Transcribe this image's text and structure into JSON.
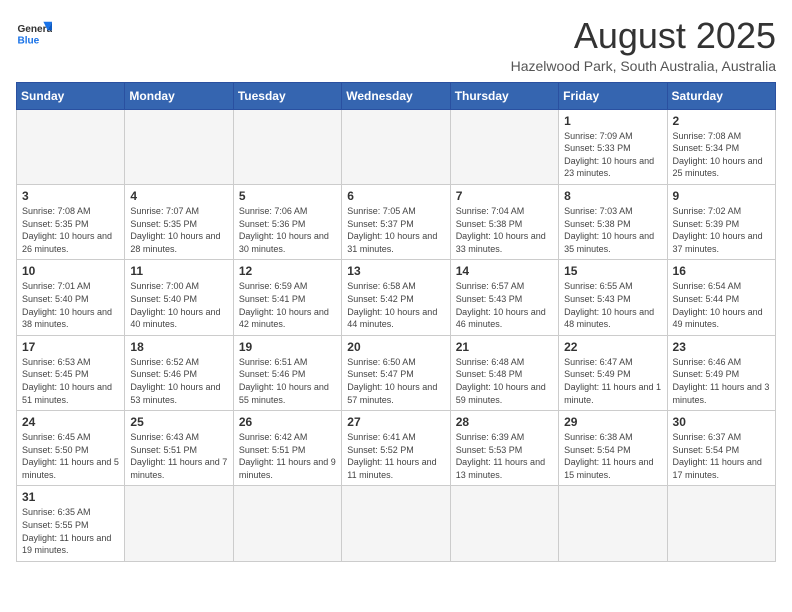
{
  "header": {
    "logo_general": "General",
    "logo_blue": "Blue",
    "title": "August 2025",
    "subtitle": "Hazelwood Park, South Australia, Australia"
  },
  "weekdays": [
    "Sunday",
    "Monday",
    "Tuesday",
    "Wednesday",
    "Thursday",
    "Friday",
    "Saturday"
  ],
  "weeks": [
    [
      {
        "day": "",
        "info": ""
      },
      {
        "day": "",
        "info": ""
      },
      {
        "day": "",
        "info": ""
      },
      {
        "day": "",
        "info": ""
      },
      {
        "day": "",
        "info": ""
      },
      {
        "day": "1",
        "info": "Sunrise: 7:09 AM\nSunset: 5:33 PM\nDaylight: 10 hours and 23 minutes."
      },
      {
        "day": "2",
        "info": "Sunrise: 7:08 AM\nSunset: 5:34 PM\nDaylight: 10 hours and 25 minutes."
      }
    ],
    [
      {
        "day": "3",
        "info": "Sunrise: 7:08 AM\nSunset: 5:35 PM\nDaylight: 10 hours and 26 minutes."
      },
      {
        "day": "4",
        "info": "Sunrise: 7:07 AM\nSunset: 5:35 PM\nDaylight: 10 hours and 28 minutes."
      },
      {
        "day": "5",
        "info": "Sunrise: 7:06 AM\nSunset: 5:36 PM\nDaylight: 10 hours and 30 minutes."
      },
      {
        "day": "6",
        "info": "Sunrise: 7:05 AM\nSunset: 5:37 PM\nDaylight: 10 hours and 31 minutes."
      },
      {
        "day": "7",
        "info": "Sunrise: 7:04 AM\nSunset: 5:38 PM\nDaylight: 10 hours and 33 minutes."
      },
      {
        "day": "8",
        "info": "Sunrise: 7:03 AM\nSunset: 5:38 PM\nDaylight: 10 hours and 35 minutes."
      },
      {
        "day": "9",
        "info": "Sunrise: 7:02 AM\nSunset: 5:39 PM\nDaylight: 10 hours and 37 minutes."
      }
    ],
    [
      {
        "day": "10",
        "info": "Sunrise: 7:01 AM\nSunset: 5:40 PM\nDaylight: 10 hours and 38 minutes."
      },
      {
        "day": "11",
        "info": "Sunrise: 7:00 AM\nSunset: 5:40 PM\nDaylight: 10 hours and 40 minutes."
      },
      {
        "day": "12",
        "info": "Sunrise: 6:59 AM\nSunset: 5:41 PM\nDaylight: 10 hours and 42 minutes."
      },
      {
        "day": "13",
        "info": "Sunrise: 6:58 AM\nSunset: 5:42 PM\nDaylight: 10 hours and 44 minutes."
      },
      {
        "day": "14",
        "info": "Sunrise: 6:57 AM\nSunset: 5:43 PM\nDaylight: 10 hours and 46 minutes."
      },
      {
        "day": "15",
        "info": "Sunrise: 6:55 AM\nSunset: 5:43 PM\nDaylight: 10 hours and 48 minutes."
      },
      {
        "day": "16",
        "info": "Sunrise: 6:54 AM\nSunset: 5:44 PM\nDaylight: 10 hours and 49 minutes."
      }
    ],
    [
      {
        "day": "17",
        "info": "Sunrise: 6:53 AM\nSunset: 5:45 PM\nDaylight: 10 hours and 51 minutes."
      },
      {
        "day": "18",
        "info": "Sunrise: 6:52 AM\nSunset: 5:46 PM\nDaylight: 10 hours and 53 minutes."
      },
      {
        "day": "19",
        "info": "Sunrise: 6:51 AM\nSunset: 5:46 PM\nDaylight: 10 hours and 55 minutes."
      },
      {
        "day": "20",
        "info": "Sunrise: 6:50 AM\nSunset: 5:47 PM\nDaylight: 10 hours and 57 minutes."
      },
      {
        "day": "21",
        "info": "Sunrise: 6:48 AM\nSunset: 5:48 PM\nDaylight: 10 hours and 59 minutes."
      },
      {
        "day": "22",
        "info": "Sunrise: 6:47 AM\nSunset: 5:49 PM\nDaylight: 11 hours and 1 minute."
      },
      {
        "day": "23",
        "info": "Sunrise: 6:46 AM\nSunset: 5:49 PM\nDaylight: 11 hours and 3 minutes."
      }
    ],
    [
      {
        "day": "24",
        "info": "Sunrise: 6:45 AM\nSunset: 5:50 PM\nDaylight: 11 hours and 5 minutes."
      },
      {
        "day": "25",
        "info": "Sunrise: 6:43 AM\nSunset: 5:51 PM\nDaylight: 11 hours and 7 minutes."
      },
      {
        "day": "26",
        "info": "Sunrise: 6:42 AM\nSunset: 5:51 PM\nDaylight: 11 hours and 9 minutes."
      },
      {
        "day": "27",
        "info": "Sunrise: 6:41 AM\nSunset: 5:52 PM\nDaylight: 11 hours and 11 minutes."
      },
      {
        "day": "28",
        "info": "Sunrise: 6:39 AM\nSunset: 5:53 PM\nDaylight: 11 hours and 13 minutes."
      },
      {
        "day": "29",
        "info": "Sunrise: 6:38 AM\nSunset: 5:54 PM\nDaylight: 11 hours and 15 minutes."
      },
      {
        "day": "30",
        "info": "Sunrise: 6:37 AM\nSunset: 5:54 PM\nDaylight: 11 hours and 17 minutes."
      }
    ],
    [
      {
        "day": "31",
        "info": "Sunrise: 6:35 AM\nSunset: 5:55 PM\nDaylight: 11 hours and 19 minutes."
      },
      {
        "day": "",
        "info": ""
      },
      {
        "day": "",
        "info": ""
      },
      {
        "day": "",
        "info": ""
      },
      {
        "day": "",
        "info": ""
      },
      {
        "day": "",
        "info": ""
      },
      {
        "day": "",
        "info": ""
      }
    ]
  ]
}
